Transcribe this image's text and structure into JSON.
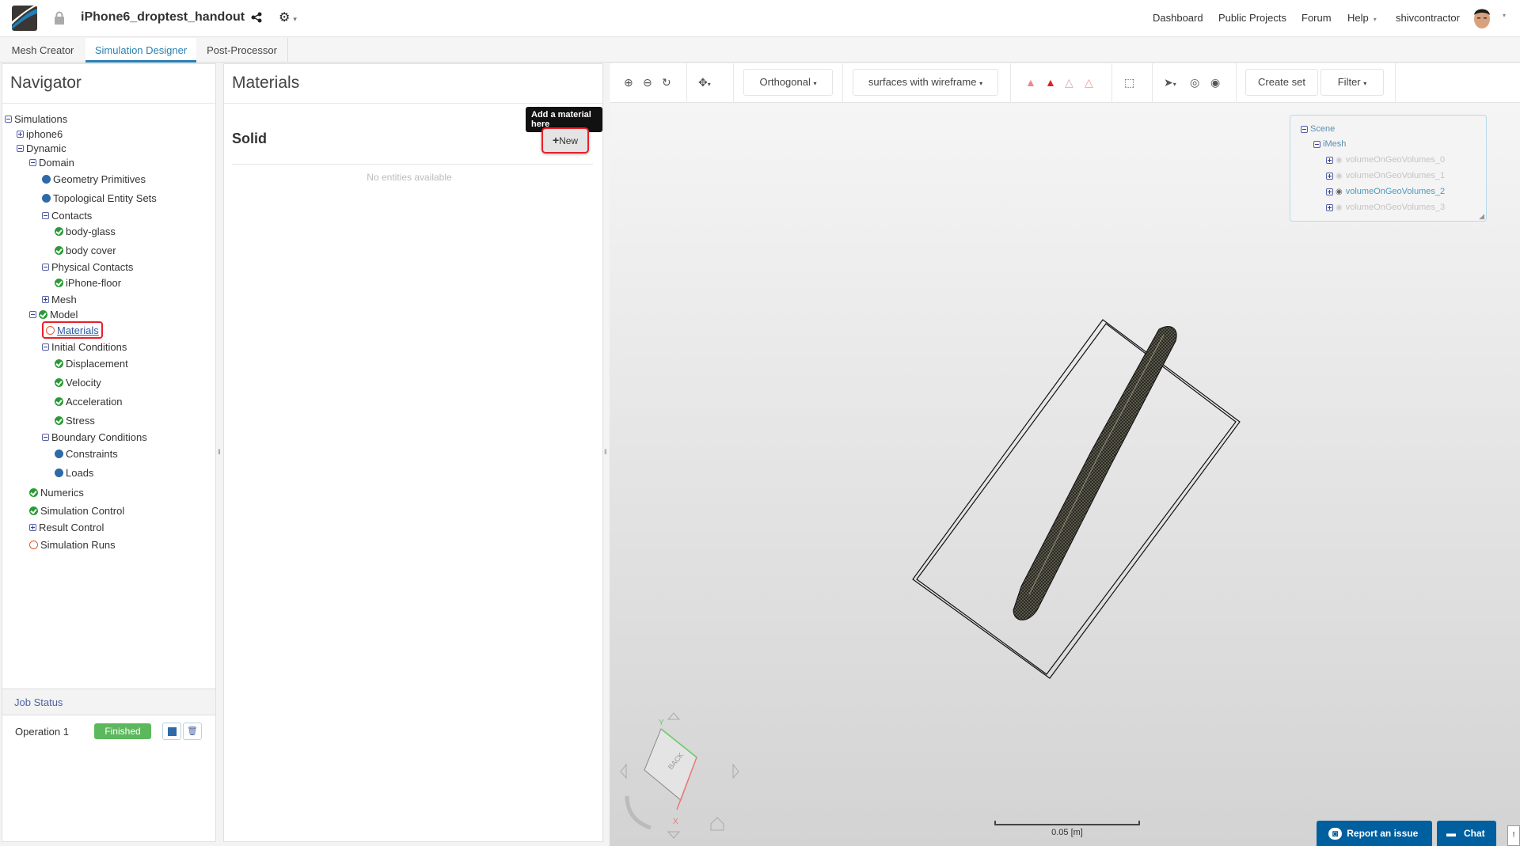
{
  "header": {
    "project_title": "iPhone6_droptest_handout",
    "nav_links": [
      "Dashboard",
      "Public Projects",
      "Forum",
      "Help"
    ],
    "username": "shivcontractor"
  },
  "tabs": [
    "Mesh Creator",
    "Simulation Designer",
    "Post-Processor"
  ],
  "navigator": {
    "title": "Navigator",
    "tree": [
      {
        "label": "Simulations",
        "level": 0,
        "icon": "minus"
      },
      {
        "label": "iphone6",
        "level": 1,
        "icon": "plus"
      },
      {
        "label": "Dynamic",
        "level": 1,
        "icon": "minus"
      },
      {
        "label": "Domain",
        "level": 2,
        "icon": "minus"
      },
      {
        "label": "Geometry Primitives",
        "level": 3,
        "icon": "dot"
      },
      {
        "label": "Topological Entity Sets",
        "level": 3,
        "icon": "dot"
      },
      {
        "label": "Contacts",
        "level": 3,
        "icon": "minus"
      },
      {
        "label": "body-glass",
        "level": 4,
        "icon": "check"
      },
      {
        "label": "body cover",
        "level": 4,
        "icon": "check"
      },
      {
        "label": "Physical Contacts",
        "level": 3,
        "icon": "minus"
      },
      {
        "label": "iPhone-floor",
        "level": 4,
        "icon": "check"
      },
      {
        "label": "Mesh",
        "level": 3,
        "icon": "plus"
      },
      {
        "label": "Model",
        "level": 2,
        "icon": "minus-check"
      },
      {
        "label": "Materials",
        "level": 3,
        "icon": "ring",
        "selected": true
      },
      {
        "label": "Initial Conditions",
        "level": 3,
        "icon": "minus"
      },
      {
        "label": "Displacement",
        "level": 4,
        "icon": "check"
      },
      {
        "label": "Velocity",
        "level": 4,
        "icon": "check"
      },
      {
        "label": "Acceleration",
        "level": 4,
        "icon": "check"
      },
      {
        "label": "Stress",
        "level": 4,
        "icon": "check"
      },
      {
        "label": "Boundary Conditions",
        "level": 3,
        "icon": "minus"
      },
      {
        "label": "Constraints",
        "level": 4,
        "icon": "dot"
      },
      {
        "label": "Loads",
        "level": 4,
        "icon": "dot"
      },
      {
        "label": "Numerics",
        "level": 2,
        "icon": "check"
      },
      {
        "label": "Simulation Control",
        "level": 2,
        "icon": "check"
      },
      {
        "label": "Result Control",
        "level": 2,
        "icon": "plus"
      },
      {
        "label": "Simulation Runs",
        "level": 2,
        "icon": "ring"
      }
    ]
  },
  "job_status": {
    "title": "Job Status",
    "operation": "Operation 1",
    "status": "Finished"
  },
  "materials": {
    "title": "Materials",
    "section": "Solid",
    "new_label": "New",
    "tooltip": "Add a material here",
    "empty": "No entities available"
  },
  "toolbar": {
    "projection": "Orthogonal",
    "render_mode": "surfaces with wireframe",
    "create_set": "Create set",
    "filter": "Filter"
  },
  "scene": {
    "root": "Scene",
    "mesh": "iMesh",
    "volumes": [
      {
        "label": "volumeOnGeoVolumes_0",
        "visible": false
      },
      {
        "label": "volumeOnGeoVolumes_1",
        "visible": false
      },
      {
        "label": "volumeOnGeoVolumes_2",
        "visible": true
      },
      {
        "label": "volumeOnGeoVolumes_3",
        "visible": false
      }
    ]
  },
  "viewer": {
    "scale_label": "0.05 [m]",
    "cube_face": "BACK",
    "axis_x": "X",
    "axis_y": "Y"
  },
  "footer": {
    "report": "Report an issue",
    "chat": "Chat"
  },
  "colors": {
    "accent": "#2a7fb0",
    "success": "#5cb85c",
    "footer_btn": "#005f9e",
    "highlight": "#e8202a"
  }
}
